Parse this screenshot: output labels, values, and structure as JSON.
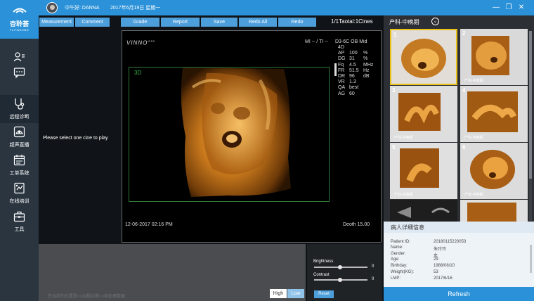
{
  "titlebar": {
    "greeting": "中午好: DANNA",
    "date": "2017年6月19日 星期一"
  },
  "logo": {
    "name": "杏聆荟",
    "sub": "FLYINSONO"
  },
  "nav": {
    "items": [
      {
        "label": "",
        "icon": "user-list-icon"
      },
      {
        "label": "",
        "icon": "chat-icon"
      },
      {
        "label": "远程诊断",
        "icon": "stethoscope-icon"
      },
      {
        "label": "超声直播",
        "icon": "ultrasound-icon"
      },
      {
        "label": "工单系统",
        "icon": "calendar-icon"
      },
      {
        "label": "在线培训",
        "icon": "training-icon"
      },
      {
        "label": "工具",
        "icon": "toolbox-icon"
      }
    ]
  },
  "toolbar": {
    "measurement": "Measurement",
    "comment": "Comment",
    "grade": "Grade",
    "report": "Report",
    "save": "Save",
    "redo_all": "Redo All",
    "redo": "Redo",
    "cines": "1/1Taotal:1Cines"
  },
  "viewer": {
    "placeholder": "Please select one cine to play",
    "brand": "VINNO",
    "brand_model": "G50",
    "mi_ti": "MI -- / TI --",
    "probe": "D3-6C   OB Mid",
    "mode": "4D",
    "params": [
      {
        "k": "AP",
        "v": "100",
        "u": "%"
      },
      {
        "k": "DG",
        "v": "31",
        "u": "%"
      },
      {
        "k": "Fq",
        "v": "4.5",
        "u": "MHz"
      },
      {
        "k": "FR",
        "v": "51.5",
        "u": "Hz"
      },
      {
        "k": "DR",
        "v": "96",
        "u": "dB"
      },
      {
        "k": "VR",
        "v": "1.3",
        "u": ""
      },
      {
        "k": "QA",
        "v": "best",
        "u": ""
      },
      {
        "k": "AG",
        "v": "60",
        "u": ""
      }
    ],
    "label_3d": "3D",
    "timestamp": "12-06-2017  02:16 PM",
    "depth": "Deoth 15.00"
  },
  "bottom": {
    "caption": "您当前的位置是>>远程诊断>>待处理数据",
    "high": "High",
    "low": "Low"
  },
  "controls": {
    "brightness_label": "Brightness",
    "brightness_value": "0",
    "contrast_label": "Contrast",
    "contrast_value": "0",
    "reset": "Reset"
  },
  "right": {
    "header": "产科-中晚期",
    "thumbs": [
      {
        "num": "1",
        "caption": ""
      },
      {
        "num": "2",
        "caption": "产科-中晚期"
      },
      {
        "num": "3",
        "caption": "产科-中晚期"
      },
      {
        "num": "4",
        "caption": "产科-中晚期"
      },
      {
        "num": "5",
        "caption": "产科-中晚期"
      },
      {
        "num": "6",
        "caption": "产科-中晚期"
      }
    ]
  },
  "patient": {
    "title": "病人详细信息",
    "fields": [
      {
        "k": "Patient ID:",
        "v": "20180115220053"
      },
      {
        "k": "Name:",
        "v": "朱玲玲"
      },
      {
        "k": "Gender:",
        "v": "女"
      },
      {
        "k": "Age:",
        "v": "29"
      },
      {
        "k": "Birthday:",
        "v": "1988/08/10"
      },
      {
        "k": "Weight(KG):",
        "v": "53"
      },
      {
        "k": "LMP:",
        "v": "2017/6/16"
      }
    ]
  },
  "refresh": "Refresh",
  "colors": {
    "accent": "#2b92d9",
    "button": "#4d9fdc",
    "selected": "#e8c21b",
    "roi": "#2f7a36",
    "label3d": "#36b24a"
  }
}
